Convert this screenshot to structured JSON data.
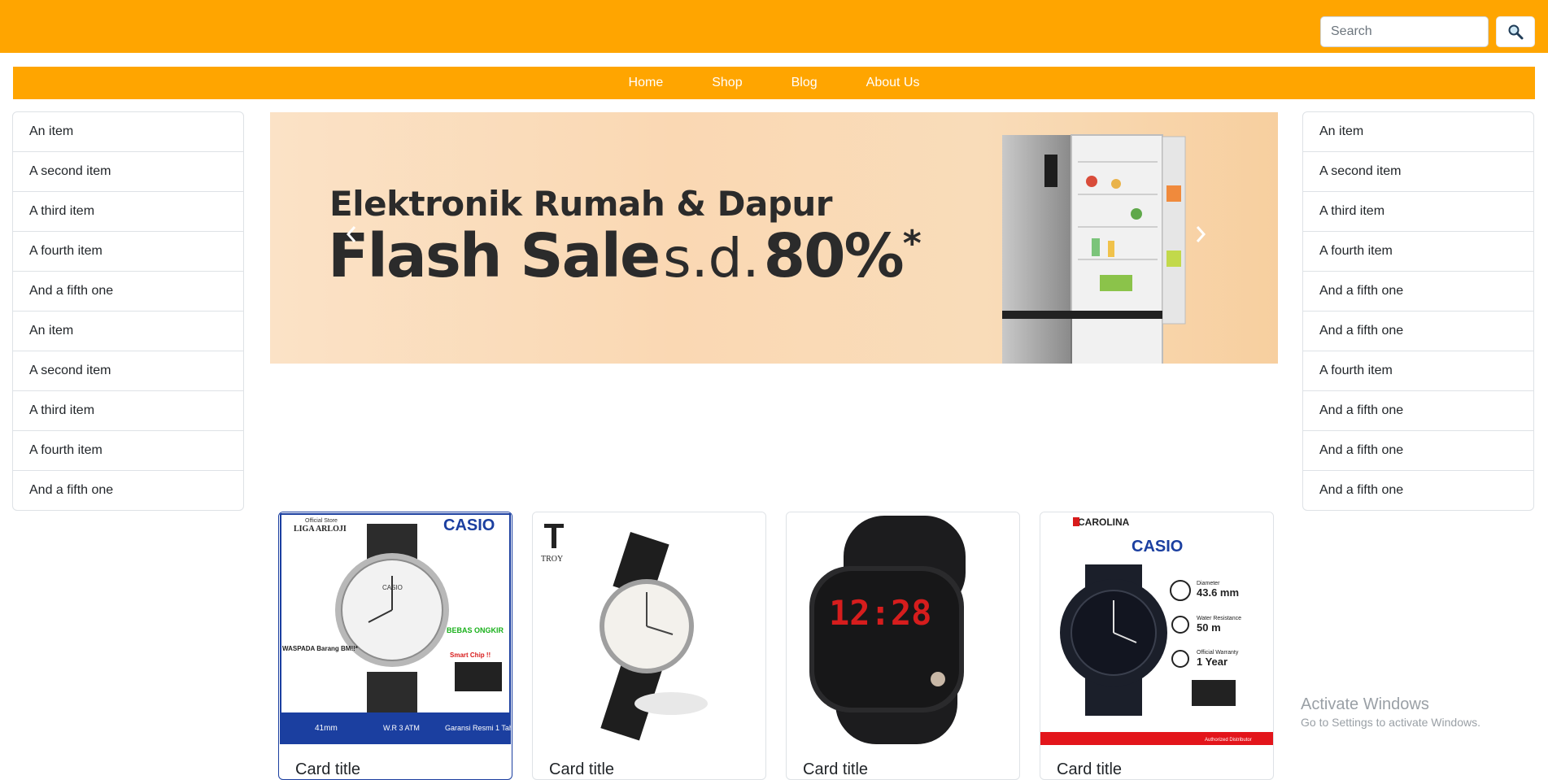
{
  "search": {
    "placeholder": "Search",
    "button_icon": "magnifier-icon"
  },
  "nav": {
    "items": [
      "Home",
      "Shop",
      "Blog",
      "About Us"
    ]
  },
  "left_list": {
    "items": [
      "An item",
      "A second item",
      "A third item",
      "A fourth item",
      "And a fifth one",
      "An item",
      "A second item",
      "A third item",
      "A fourth item",
      "And a fifth one"
    ]
  },
  "right_list": {
    "items": [
      "An item",
      "A second item",
      "A third item",
      "A fourth item",
      "And a fifth one",
      "And a fifth one",
      "A fourth item",
      "And a fifth one",
      "And a fifth one",
      "And a fifth one"
    ]
  },
  "banner": {
    "line1": "Elektronik Rumah & Dapur",
    "line2_part1": "Flash Sale",
    "line2_part2": "s.d.",
    "line2_part3": "80%",
    "line2_star": "*"
  },
  "cards": [
    {
      "title": "Card title",
      "brand": "CASIO",
      "store": "LIGA ARLOJI",
      "store_sub": "Official Store",
      "badges": [
        "41mm",
        "W.R 3 ATM",
        "Garansi Resmi 1 Tahun"
      ],
      "tag1": "BEBAS ONGKIR",
      "tag2": "WASPADA Barang BM!!*",
      "tag3": "Smart Chip !!",
      "dial": "CASIO"
    },
    {
      "title": "Card title",
      "brand": "TROY"
    },
    {
      "title": "Card title",
      "display": "12:28"
    },
    {
      "title": "Card title",
      "store": "CAROLINA",
      "brand": "CASIO",
      "specs": [
        "Diameter",
        "43.6 mm",
        "Water Resistance",
        "50 m",
        "Official Warranty",
        "1 Year"
      ],
      "footer": "Authorized Distributor"
    }
  ],
  "watermark": {
    "line1": "Activate Windows",
    "line2": "Go to Settings to activate Windows."
  },
  "colors": {
    "accent": "#ffa500"
  }
}
